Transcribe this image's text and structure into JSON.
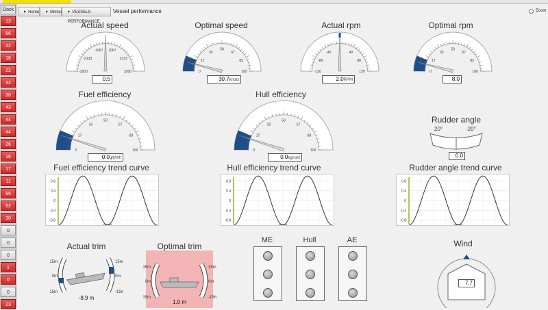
{
  "topbar": {
    "tab_color": "#f2e200"
  },
  "sidebar": {
    "dock_label": "Dock",
    "items": [
      {
        "label": "13",
        "state": "red"
      },
      {
        "label": "66",
        "state": "red"
      },
      {
        "label": "22",
        "state": "red"
      },
      {
        "label": "18",
        "state": "red"
      },
      {
        "label": "22",
        "state": "red"
      },
      {
        "label": "32",
        "state": "red"
      },
      {
        "label": "38",
        "state": "red"
      },
      {
        "label": "43",
        "state": "red"
      },
      {
        "label": "44",
        "state": "red"
      },
      {
        "label": "44",
        "state": "red"
      },
      {
        "label": "26",
        "state": "red"
      },
      {
        "label": "16",
        "state": "red"
      },
      {
        "label": "17",
        "state": "red"
      },
      {
        "label": "11",
        "state": "red"
      },
      {
        "label": "99",
        "state": "red"
      },
      {
        "label": "52",
        "state": "red"
      },
      {
        "label": "30",
        "state": "red"
      },
      {
        "label": "0",
        "state": "gray"
      },
      {
        "label": "0",
        "state": "gray"
      },
      {
        "label": "0",
        "state": "gray"
      },
      {
        "label": "1",
        "state": "red"
      },
      {
        "label": "0",
        "state": "red"
      },
      {
        "label": "0",
        "state": "gray"
      },
      {
        "label": "23",
        "state": "red"
      }
    ]
  },
  "breadcrumb": {
    "items": [
      "Home",
      "Mimics",
      "VESSELS PERFORMANCE"
    ],
    "title": "Vessel performance"
  },
  "zoom_label": "Zoom",
  "gauges": {
    "actual_speed": {
      "title": "Actual speed",
      "ticks": [
        "-3200",
        "-2133",
        "-1067",
        "1067",
        "2133",
        "3200"
      ],
      "value": "0.5",
      "unit": "",
      "needle_fraction": 0.5
    },
    "optimal_speed": {
      "title": "Optimal speed",
      "ticks": [
        "0",
        "17",
        "33",
        "50",
        "67",
        "83",
        "100"
      ],
      "value": "30.7",
      "unit": "knots",
      "needle_fraction": 0.08
    },
    "actual_rpm": {
      "title": "Actual rpm",
      "ticks": [
        "-120",
        "-80",
        "-40",
        "0",
        "40",
        "80",
        "120"
      ],
      "value": "2.0",
      "unit": "RPM",
      "needle_fraction": 0.5
    },
    "optimal_rpm": {
      "title": "Optimal rpm",
      "ticks": [
        "0",
        "17",
        "33",
        "50",
        "67",
        "83",
        "100"
      ],
      "value": "8.0",
      "unit": "",
      "needle_fraction": 0.08
    },
    "fuel_efficiency": {
      "title": "Fuel efficiency",
      "ticks": [
        "0",
        "17",
        "33",
        "50",
        "67",
        "83",
        "100"
      ],
      "value": "0.0",
      "unit": "g/kWh",
      "needle_fraction": 0.1
    },
    "hull_efficiency": {
      "title": "Hull efficiency",
      "ticks": [
        "0",
        "17",
        "33",
        "50",
        "67",
        "83",
        "100"
      ],
      "value": "0.0",
      "unit": "kg/nmi",
      "needle_fraction": 0.1
    }
  },
  "rudder": {
    "title": "Rudder angle",
    "left_label": "20°",
    "right_label": "-20°",
    "value": "0.0"
  },
  "trends": {
    "fuel": {
      "title": "Fuel efficiency trend curve"
    },
    "hull": {
      "title": "Hull efficiency trend curve"
    },
    "rudder": {
      "title": "Rudder angle trend curve"
    },
    "y_ticks": [
      "0.8",
      "0.4",
      "0",
      "-0.4",
      "-0.8"
    ],
    "x_label": "03:00",
    "line_color": "#333333"
  },
  "trim": {
    "actual": {
      "title": "Actual trim",
      "labels": [
        "15m",
        "0m",
        "-15m"
      ],
      "value": "-8.9",
      "unit": "m"
    },
    "optimal": {
      "title": "Optimal trim",
      "labels": [
        "15m",
        "0m",
        "-15m"
      ],
      "value": "1.0",
      "unit": "m",
      "background": "#f2b4b4"
    }
  },
  "status_panels": [
    {
      "title": "ME"
    },
    {
      "title": "Hull"
    },
    {
      "title": "AE"
    }
  ],
  "wind": {
    "title": "Wind",
    "value": "7.7"
  },
  "colors": {
    "gauge_fill": "#1f4f8a",
    "alarm_red": "#cc2a2a"
  }
}
